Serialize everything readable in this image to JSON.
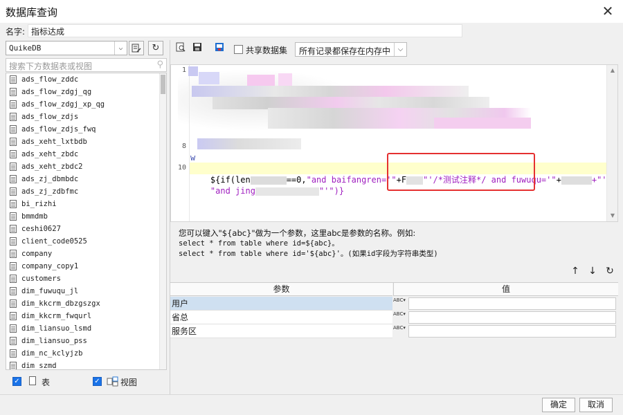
{
  "window": {
    "title": "数据库查询",
    "close_glyph": "✕"
  },
  "name_row": {
    "label": "名字:",
    "value": "指标达成"
  },
  "left": {
    "db_selected": "QuikeDB",
    "search_placeholder": "搜索下方数据表或视图",
    "tables": [
      "ads_flow_zddc",
      "ads_flow_zdgj_qg",
      "ads_flow_zdgj_xp_qg",
      "ads_flow_zdjs",
      "ads_flow_zdjs_fwq",
      "ads_xeht_lxtbdb",
      "ads_xeht_zbdc",
      "ads_xeht_zbdc2",
      "ads_zj_dbmbdc",
      "ads_zj_zdbfmc",
      "bi_rizhi",
      "bmmdmb",
      "ceshi0627",
      "client_code0525",
      "company",
      "company_copy1",
      "customers",
      "dim_fuwuqu_jl",
      "dim_kkcrm_dbzgszgx",
      "dim_kkcrm_fwqurl",
      "dim_liansuo_lsmd",
      "dim_liansuo_pss",
      "dim_nc_kclyjzb",
      "dim_szmd"
    ],
    "check_table_label": "表",
    "check_view_label": "视图"
  },
  "right": {
    "share_label": "共享数据集",
    "memory_select": "所有记录都保存在内存中",
    "line_numbers": [
      "1",
      "8",
      "10"
    ],
    "code": {
      "line_w": "w",
      "l10_a": "${if(len",
      "l10_b": "==0,",
      "l10_c": "\"and baifangren='\"",
      "l10_d": "+F",
      "l10_e": "\"'/*测试注释*/ and fuwuqu='\"",
      "l10_f": "+",
      "l10_g": "+\"'\",",
      "l11_a": "\"and jing",
      "l11_b": "\"'\")}"
    },
    "help": {
      "line1": "您可以键入\"${abc}\"做为一个参数，这里abc是参数的名称。例如:",
      "line2": "select * from table where id=${abc}。",
      "line3": "select * from table where id='${abc}'。(如果id字段为字符串类型)"
    },
    "arrows": {
      "up": "↑",
      "down": "↓",
      "refresh": "↻"
    },
    "params": {
      "col_param": "参数",
      "col_value": "值",
      "rows": [
        {
          "name": "用户",
          "type": "ABC"
        },
        {
          "name": "省总",
          "type": "ABC"
        },
        {
          "name": "服务区",
          "type": "ABC"
        }
      ]
    }
  },
  "buttons": {
    "ok": "确定",
    "cancel": "取消"
  },
  "colors": {
    "annotation": "#e53030",
    "highlight_line": "#ffffcc",
    "selected_row": "#cfe0f1",
    "string": "#a020c0"
  }
}
